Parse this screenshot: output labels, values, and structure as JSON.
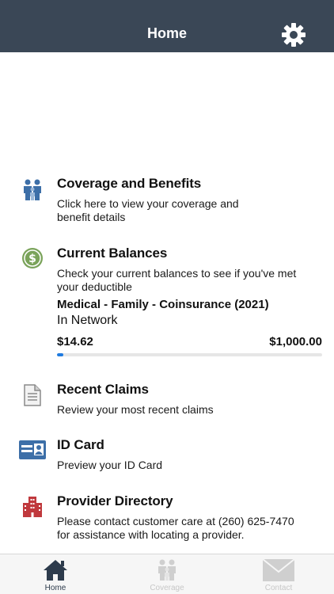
{
  "header": {
    "title": "Home",
    "settings_icon": "gear-icon"
  },
  "sections": {
    "coverage": {
      "icon": "family-icon",
      "title": "Coverage and Benefits",
      "desc_line1": "Click here to view your coverage and",
      "desc_line2": "benefit details"
    },
    "balances": {
      "icon": "dollar-coin-icon",
      "title": "Current Balances",
      "desc_line1": "Check your current balances to see if you've met",
      "desc_line2": "your deductible",
      "plan_name": "Medical - Family - Coinsurance (2021)",
      "network": "In Network",
      "amount_met": "$14.62",
      "amount_total": "$1,000.00",
      "progress_fraction": 0.0146
    },
    "claims": {
      "icon": "document-icon",
      "title": "Recent Claims",
      "desc": "Review your most recent claims"
    },
    "idcard": {
      "icon": "id-card-icon",
      "title": "ID Card",
      "desc": "Preview your ID Card"
    },
    "provider": {
      "icon": "building-icon",
      "title": "Provider Directory",
      "desc_line1": "Please contact customer care at (260) 625-7470",
      "desc_line2": "for assistance with locating a provider."
    }
  },
  "tabs": [
    {
      "label": "Home",
      "icon": "house-icon",
      "active": true
    },
    {
      "label": "Coverage",
      "icon": "family-icon",
      "active": false
    },
    {
      "label": "Contact",
      "icon": "envelope-icon",
      "active": false
    }
  ],
  "colors": {
    "header_bg": "#3a4756",
    "accent_blue": "#1f7be0",
    "coverage_icon": "#3d6fa8",
    "balance_icon": "#7aa35a",
    "provider_icon": "#c0393d",
    "idcard_icon": "#3d6fa8"
  }
}
